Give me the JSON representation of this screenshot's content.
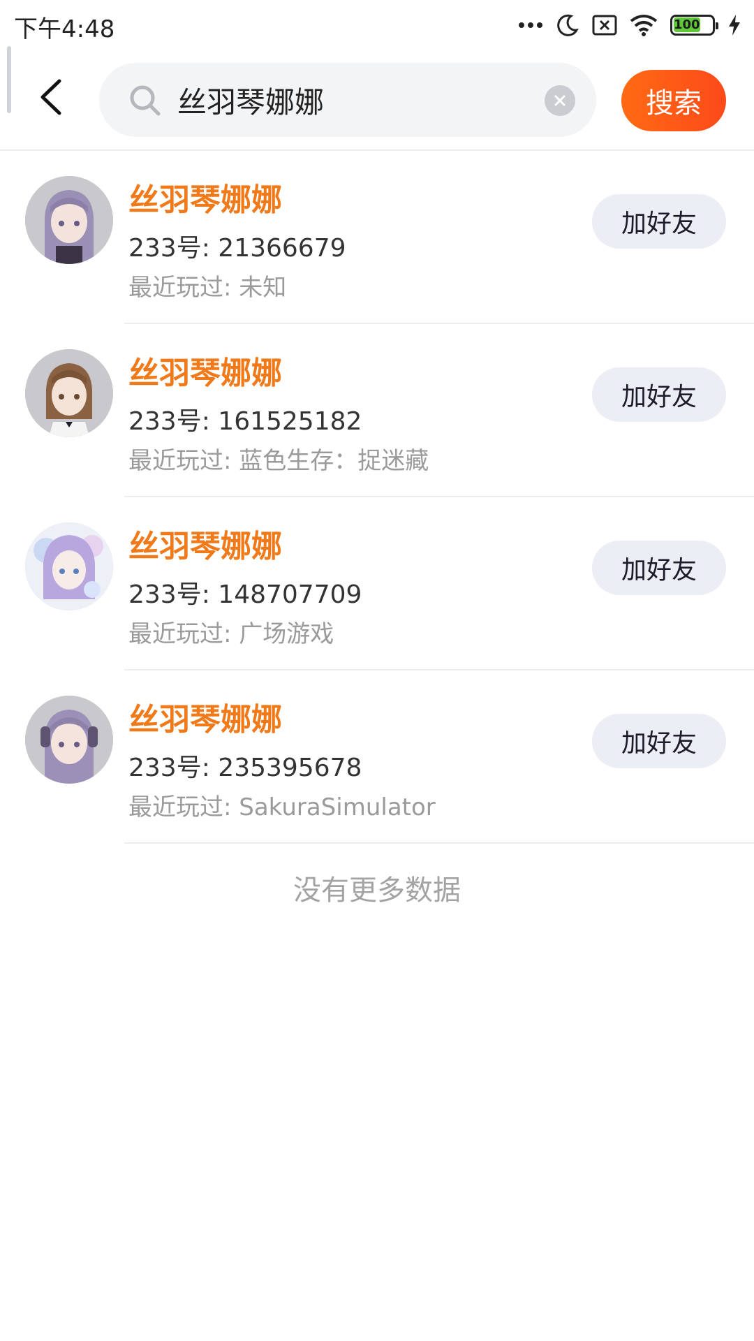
{
  "status_bar": {
    "time": "下午4:48",
    "battery_level": "100",
    "icons": [
      "more-dots-icon",
      "moon-icon",
      "sim-x-icon",
      "wifi-icon",
      "battery-icon",
      "charging-icon"
    ]
  },
  "header": {
    "back_icon": "chevron-left-icon",
    "search": {
      "value": "丝羽琴娜娜",
      "icon": "search-icon",
      "clear_icon": "clear-circle-icon"
    },
    "search_button_label": "搜索"
  },
  "results": [
    {
      "name": "丝羽琴娜娜",
      "id_line": "233号: 21366679",
      "recent_line": "最近玩过: 未知",
      "add_label": "加好友"
    },
    {
      "name": "丝羽琴娜娜",
      "id_line": "233号: 161525182",
      "recent_line": "最近玩过: 蓝色生存：捉迷藏",
      "add_label": "加好友"
    },
    {
      "name": "丝羽琴娜娜",
      "id_line": "233号: 148707709",
      "recent_line": "最近玩过: 广场游戏",
      "add_label": "加好友"
    },
    {
      "name": "丝羽琴娜娜",
      "id_line": "233号: 235395678",
      "recent_line": "最近玩过: SakuraSimulator",
      "add_label": "加好友"
    }
  ],
  "footer_text": "没有更多数据",
  "colors": {
    "accent_orange": "#f07a1a",
    "search_button": "#fc5a16",
    "add_button_bg": "#eceef5",
    "search_bg": "#f3f4f6"
  }
}
